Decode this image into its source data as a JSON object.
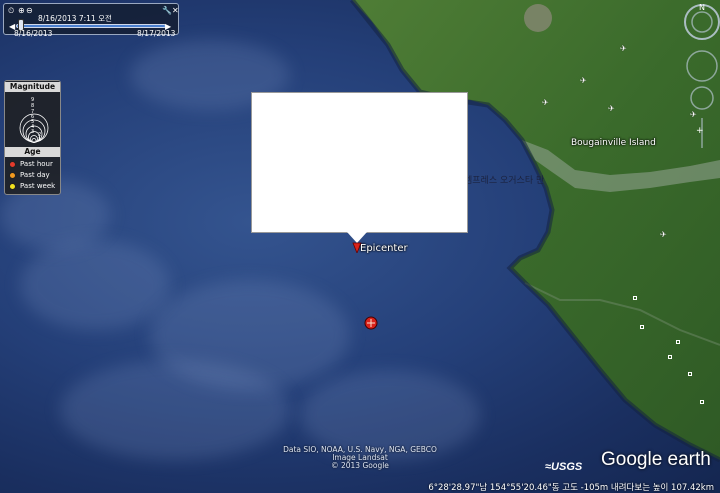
{
  "time_slider": {
    "current": "8/16/2013   7:11 오전",
    "start": "8/16/2013",
    "end": "8/17/2013"
  },
  "legend": {
    "magnitude_title": "Magnitude",
    "magnitude_scale": [
      "9",
      "8",
      "7",
      "6",
      "5",
      "4",
      "3",
      "2",
      "1"
    ],
    "age_title": "Age",
    "age_items": [
      {
        "label": "Past hour",
        "color": "#e53b2c"
      },
      {
        "label": "Past day",
        "color": "#f29a1f"
      },
      {
        "label": "Past week",
        "color": "#f2e21f"
      }
    ]
  },
  "map_labels": {
    "epicenter": "Epicenter",
    "island": "Bougainville Island",
    "bay": "엠프레스 오거스타 만"
  },
  "attribution": {
    "line1": "Data SIO, NOAA, U.S. Navy, NGA, GEBCO",
    "line2": "Image Landsat",
    "line3": "© 2013 Google"
  },
  "status_bar": {
    "text": "6°28'28.97\"남  154°55'20.46\"동  고도  -105m   내려다보는 높이 107.42km"
  },
  "branding": {
    "usgs": "≈USGS",
    "google_earth": "Google earth"
  },
  "colors": {
    "ocean": "#243f78",
    "land": "#3d6b2c",
    "epicenter_marker": "#d9221a"
  }
}
